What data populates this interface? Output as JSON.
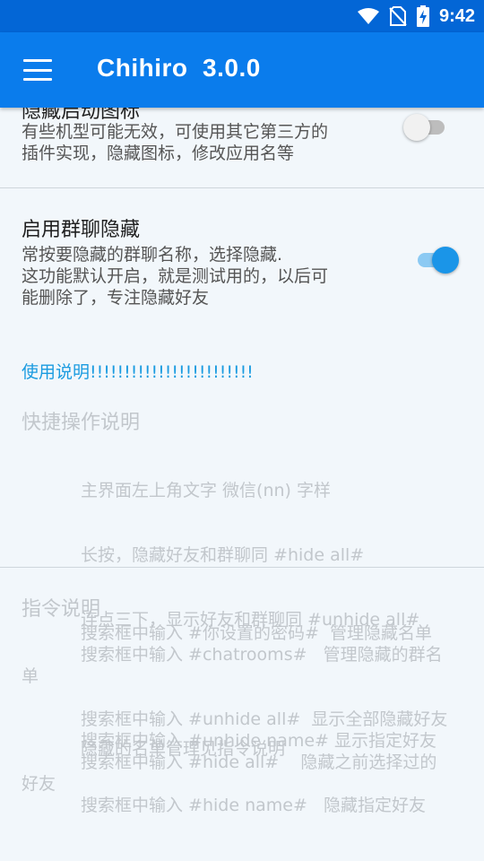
{
  "status_bar": {
    "time": "9:42",
    "icons": [
      "wifi-icon",
      "no-sim-icon",
      "battery-charging-icon"
    ]
  },
  "app_bar": {
    "title": "Chihiro  3.0.0",
    "menu_icon": "hamburger-menu-icon"
  },
  "prefs": [
    {
      "title": "隐藏启动图标",
      "summary_lines": [
        "有些机型可能无效，可使用其它第三方的",
        "插件实现，隐藏图标，修改应用名等"
      ],
      "switch_on": false
    },
    {
      "title": "启用群聊隐藏",
      "summary_lines": [
        "常按要隐藏的群聊名称，选择隐藏.",
        "这功能默认开启，就是测试用的，以后可",
        "能删除了，专注隐藏好友"
      ],
      "switch_on": true
    }
  ],
  "usage_link": "使用说明!!!!!!!!!!!!!!!!!!!!!!!!",
  "quick_ops": {
    "title": "快捷操作说明",
    "lines": [
      "主界面左上角文字 微信(nn) 字样",
      "长按，隐藏好友和群聊同 #hide all#",
      "连点三下，显示好友和群聊同 #unhide all#",
      "",
      "隐藏的名单管理见指令说明"
    ]
  },
  "commands": {
    "title": "指令说明",
    "lines": [
      "搜索框中输入 #你设置的密码#  管理隐藏名单",
      "搜索框中输入 #chatrooms#   管理隐藏的群名",
      "单",
      "",
      "搜索框中输入 #unhide all#  显示全部隐藏好友",
      "搜索框中输入 #unhide name# 显示指定好友",
      "搜索框中输入 #hide all#    隐藏之前选择过的",
      "好友",
      "搜索框中输入 #hide name#   隐藏指定好友"
    ]
  },
  "colors": {
    "status_bar": "#0366d6",
    "app_bar": "#0a7cec",
    "accent": "#1a95e8",
    "background": "#f2f7fb"
  }
}
